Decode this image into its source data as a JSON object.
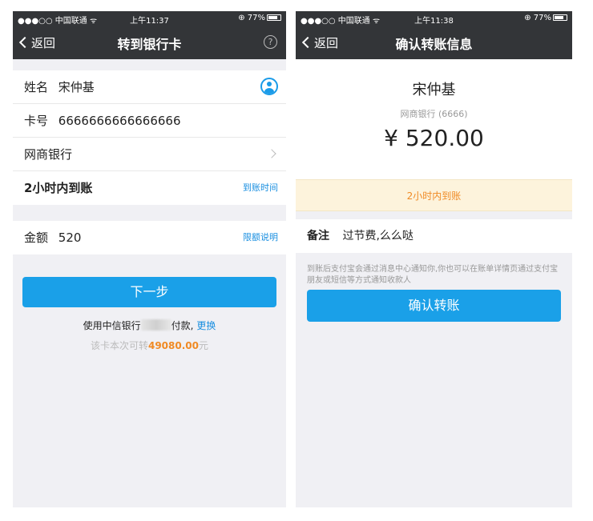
{
  "left": {
    "status": {
      "carrier": "●●●○○ 中国联通 ᯤ",
      "time": "上午11:37",
      "battery": "⊕ 77%"
    },
    "nav": {
      "back": "返回",
      "title": "转到银行卡",
      "help": "?"
    },
    "form": {
      "name_label": "姓名",
      "name_value": "宋仲基",
      "card_label": "卡号",
      "card_value": "6666666666666666",
      "bank": "网商银行",
      "speed": "2小时内到账",
      "speed_link": "到账时间",
      "amount_label": "金额",
      "amount_value": "520",
      "amount_link": "限额说明"
    },
    "next_button": "下一步",
    "pay_prefix": "使用中信银行",
    "pay_suffix": "付款,",
    "pay_change": "更换",
    "limit_prefix": "该卡本次可转",
    "limit_amount": "49080.00",
    "limit_suffix": "元"
  },
  "right": {
    "status": {
      "carrier": "●●●○○ 中国联通 ᯤ",
      "time": "上午11:38",
      "battery": "⊕ 77%"
    },
    "nav": {
      "back": "返回",
      "title": "确认转账信息"
    },
    "recipient": "宋仲基",
    "bank_info": "网商银行 (6666)",
    "amount": "¥ 520.00",
    "notice": "2小时内到账",
    "remark_label": "备注",
    "remark_value": "过节费,么么哒",
    "hint": "到账后支付宝会通过消息中心通知你,你也可以在账单详情页通过支付宝朋友或短信等方式通知收款人",
    "confirm_button": "确认转账"
  },
  "colors": {
    "accent": "#1aa0e8",
    "orange": "#f08a24",
    "navbar": "#333538",
    "notice_bg": "#fdf3dc"
  }
}
